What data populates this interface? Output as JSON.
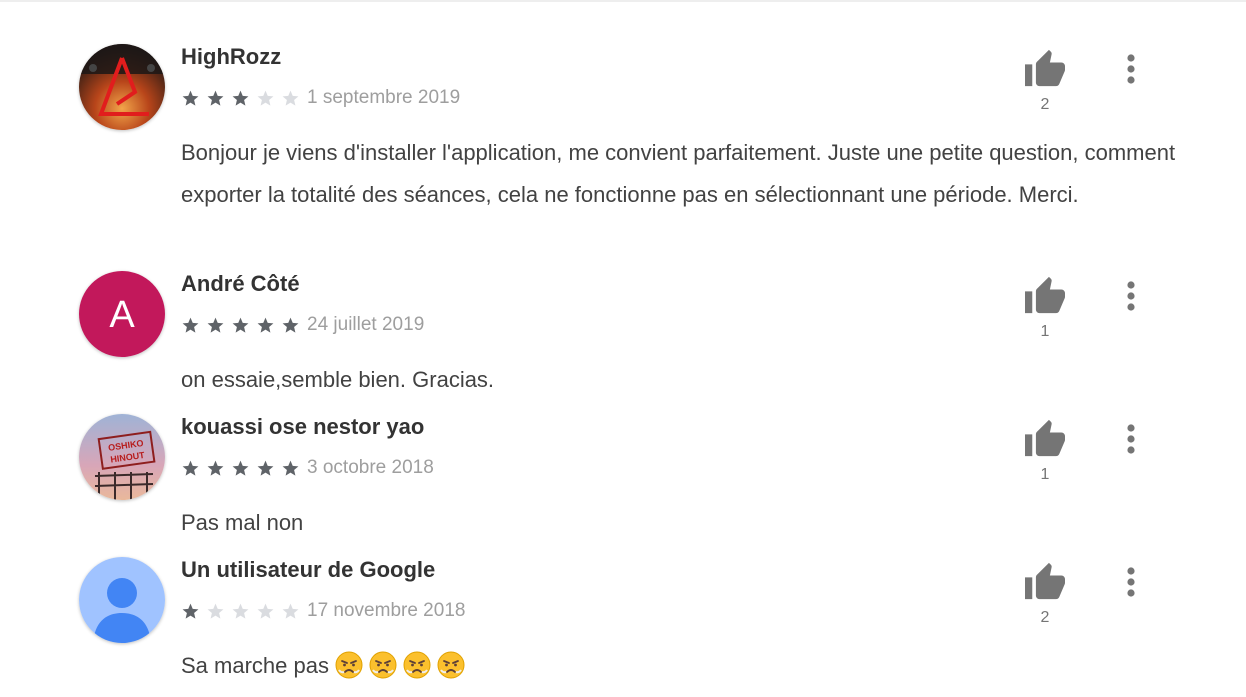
{
  "reviews": [
    {
      "author": "HighRozz",
      "rating": 3,
      "date": "1 septembre 2019",
      "text": "Bonjour je viens d'installer l'application, me convient parfaitement. Juste une petite question, comment exporter la totalité des séances, cela ne fonctionne pas en sélectionnant une période. Merci.",
      "likes": "2",
      "avatar": "avatar-photo-dark-orange"
    },
    {
      "author": "André Côté",
      "rating": 5,
      "date": "24 juillet 2019",
      "text": "on essaie,semble bien. Gracias.",
      "likes": "1",
      "avatar_letter": "A",
      "avatar_color": "#c2185b"
    },
    {
      "author": "kouassi ose nestor yao",
      "rating": 5,
      "date": "3 octobre 2018",
      "text": "Pas mal non",
      "likes": "1",
      "avatar": "avatar-photo-sign-sky"
    },
    {
      "author": "Un utilisateur de Google",
      "rating": 1,
      "date": "17 novembre 2018",
      "text": "Sa marche pas",
      "emojis": [
        "😤",
        "😤",
        "😤",
        "😤"
      ],
      "likes": "2",
      "avatar": "default-user-icon"
    }
  ],
  "colors": {
    "star_filled": "#5f6368",
    "star_empty": "#dadce0",
    "icon": "#757575"
  },
  "icons": {
    "like": "thumb-up-icon",
    "menu": "more-vert-icon",
    "star": "star-icon"
  }
}
